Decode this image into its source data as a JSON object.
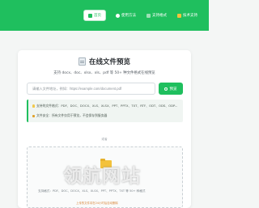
{
  "nav": [
    {
      "label": "首页",
      "icon": "home-icon",
      "active": true
    },
    {
      "label": "使用方法",
      "icon": "help-icon",
      "active": false
    },
    {
      "label": "支持格式",
      "icon": "format-icon",
      "active": false
    },
    {
      "label": "技术支持",
      "icon": "support-icon",
      "active": false
    }
  ],
  "main": {
    "title": "在线文件预览",
    "subtitle": "支持 docx、doc、xlsx、xls、pdf 等 50+ 种文件格式在线预览",
    "url_placeholder": "请输入文件地址，例如：https://example.com/document.pdf",
    "preview_button": "预览"
  },
  "info": {
    "formats": "支持的文件格式：PDF、DOC、DOCX、XLS、XLSX、PPT、PPTX、TXT、RTF、ODT、ODS、ODP...",
    "security": "文件安全：所有文件仅用于预览，不会保存到服务器"
  },
  "upload": {
    "or_label": "或者",
    "drop_text": "支持格式：PDF、DOC、DOCX、XLS、XLSX、PPT、PPTX、TXT 等 50+ 种格式",
    "note": "上传的文件将在24小时后自动删除"
  },
  "watermark": "领航网站",
  "colors": {
    "accent": "#1fbf5e",
    "background": "#f4f6f5"
  }
}
